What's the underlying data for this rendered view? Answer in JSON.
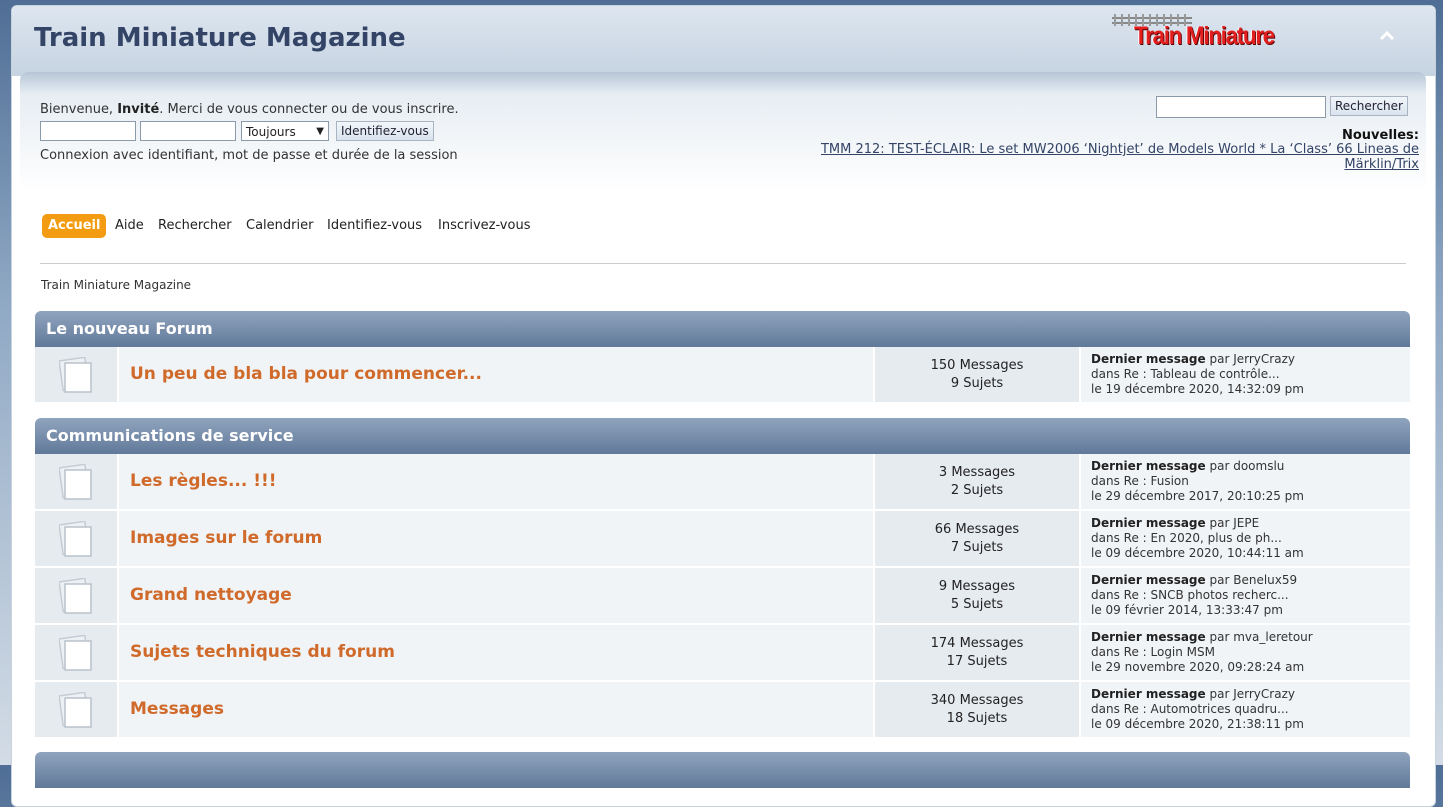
{
  "header": {
    "forum_title": "Train Miniature Magazine",
    "logo_text": "Train Miniature"
  },
  "userbox": {
    "welcome_prefix": "Bienvenue, ",
    "guest": "Invité",
    "welcome_suffix": ". Merci de vous connecter ou de vous inscrire.",
    "session_options": [
      "Toujours"
    ],
    "session_selected": "Toujours",
    "login_button": "Identifiez-vous",
    "session_hint": "Connexion avec identifiant, mot de passe et durée de la session",
    "search_button": "Rechercher",
    "news_label": "Nouvelles:",
    "news_text": "TMM 212: TEST-ÉCLAIR: Le set MW2006 ‘Nightjet’ de Models World * La ‘Class’ 66 Lineas de Märklin/Trix"
  },
  "nav": {
    "items": [
      "Accueil",
      "Aide",
      "Rechercher",
      "Calendrier",
      "Identifiez-vous",
      "Inscrivez-vous"
    ],
    "active": "Accueil"
  },
  "breadcrumb": "Train Miniature Magazine",
  "categories": [
    {
      "title": "Le nouveau Forum",
      "boards": [
        {
          "name": "Un peu de bla bla pour commencer...",
          "messages": "150 Messages",
          "topics": "9 Sujets",
          "last_label": "Dernier message",
          "last_by": "par JerryCrazy",
          "last_in": "dans Re : Tableau de contrôle...",
          "last_date": "le 19 décembre 2020, 14:32:09 pm"
        }
      ]
    },
    {
      "title": "Communications de service",
      "boards": [
        {
          "name": "Les règles... !!!",
          "messages": "3 Messages",
          "topics": "2 Sujets",
          "last_label": "Dernier message",
          "last_by": "par doomslu",
          "last_in": "dans Re : Fusion",
          "last_date": "le 29 décembre 2017, 20:10:25 pm"
        },
        {
          "name": "Images sur le forum",
          "messages": "66 Messages",
          "topics": "7 Sujets",
          "last_label": "Dernier message",
          "last_by": "par JEPE",
          "last_in": "dans Re : En 2020, plus de ph...",
          "last_date": "le 09 décembre 2020, 10:44:11 am"
        },
        {
          "name": "Grand nettoyage",
          "messages": "9 Messages",
          "topics": "5 Sujets",
          "last_label": "Dernier message",
          "last_by": "par Benelux59",
          "last_in": "dans Re : SNCB photos recherc...",
          "last_date": "le 09 février 2014, 13:33:47 pm"
        },
        {
          "name": "Sujets techniques du forum",
          "messages": "174 Messages",
          "topics": "17 Sujets",
          "last_label": "Dernier message",
          "last_by": "par mva_leretour",
          "last_in": "dans Re : Login MSM",
          "last_date": "le 29 novembre 2020, 09:28:24 am"
        },
        {
          "name": "Messages",
          "messages": "340 Messages",
          "topics": "18 Sujets",
          "last_label": "Dernier message",
          "last_by": "par JerryCrazy",
          "last_in": "dans Re : Automotrices quadru...",
          "last_date": "le 09 décembre 2020, 21:38:11 pm"
        }
      ]
    }
  ],
  "colors": {
    "accent_nav": "#f39c12",
    "board_link": "#d06a2a",
    "category_bar": "#61799a"
  }
}
